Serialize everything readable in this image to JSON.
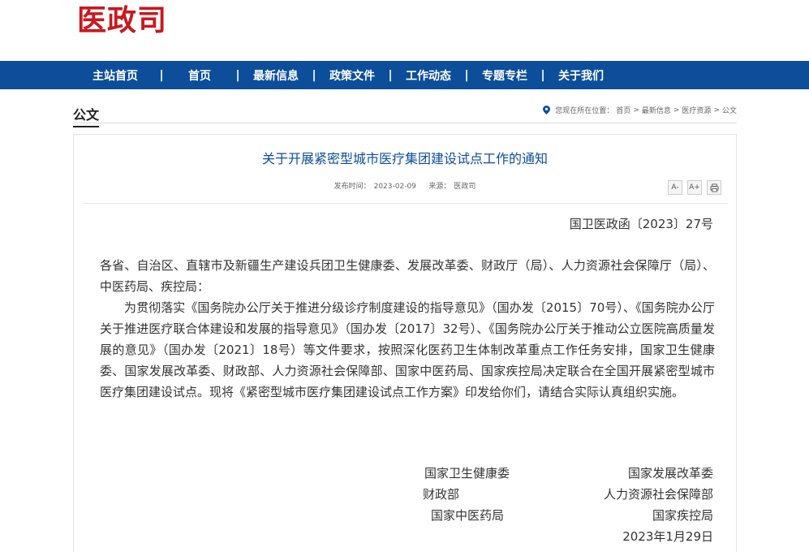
{
  "logo": "医政司",
  "nav": {
    "items": [
      "主站首页",
      "首页",
      "最新信息",
      "政策文件",
      "工作动态",
      "专题专栏",
      "关于我们"
    ],
    "separator": "|"
  },
  "section": {
    "title": "公文"
  },
  "breadcrumb": {
    "prefix": "您现在所在位置：",
    "items": [
      "首页",
      "最新信息",
      "医疗资源",
      "公文"
    ],
    "separator": ">"
  },
  "article": {
    "title": "关于开展紧密型城市医疗集团建设试点工作的通知",
    "publish_label": "发布时间：",
    "publish_date": "2023-02-09",
    "source_label": "来源：",
    "source": "医政司",
    "doc_number": "国卫医政函〔2023〕27号",
    "salutation": "各省、自治区、直辖市及新疆生产建设兵团卫生健康委、发展改革委、财政厅（局）、人力资源社会保障厅（局）、中医药局、疾控局：",
    "paragraph": "为贯彻落实《国务院办公厅关于推进分级诊疗制度建设的指导意见》（国办发〔2015〕70号）、《国务院办公厅关于推进医疗联合体建设和发展的指导意见》（国办发〔2017〕32号）、《国务院办公厅关于推动公立医院高质量发展的意见》（国办发〔2021〕18号）等文件要求，按照深化医药卫生体制改革重点工作任务安排，国家卫生健康委、国家发展改革委、财政部、人力资源社会保障部、国家中医药局、国家疾控局决定联合在全国开展紧密型城市医疗集团建设试点。现将《紧密型城市医疗集团建设试点工作方案》印发给你们，请结合实际认真组织实施。",
    "signatures": {
      "left": [
        "国家卫生健康委",
        "财政部",
        "国家中医药局"
      ],
      "right": [
        "国家发展改革委",
        "人力资源社会保障部",
        "国家疾控局"
      ],
      "date": "2023年1月29日"
    }
  },
  "tools": {
    "font_smaller": "A-",
    "font_larger": "A+"
  }
}
